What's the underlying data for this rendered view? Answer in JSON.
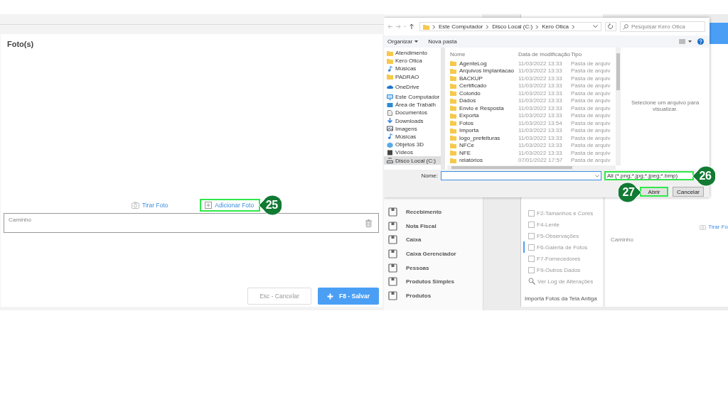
{
  "left_screen": {
    "title": "Foto(s)",
    "take_photo": {
      "label": "Tirar Foto"
    },
    "add_photo": {
      "label": "Adicionar Foto",
      "highlighted": true,
      "callout": "25"
    },
    "path_field": {
      "placeholder": "Caminho"
    },
    "buttons": [
      {
        "label": "Esc - Cancelar",
        "kind": "secondary"
      },
      {
        "label": "F8 - Salvar",
        "kind": "primary"
      }
    ]
  },
  "right_screen": {
    "app_sidebar": [
      {
        "label": "Recebimento"
      },
      {
        "label": "Nota Fiscal"
      },
      {
        "label": "Caixa"
      },
      {
        "label": "Caixa Gerenciador"
      },
      {
        "label": "Pessoas"
      },
      {
        "label": "Produtos Simples"
      },
      {
        "label": "Produtos"
      }
    ],
    "tabs": [
      {
        "label": "F2-Tamanhos  e Cores",
        "selected": false
      },
      {
        "label": "F4-Lente",
        "selected": false
      },
      {
        "label": "F5-Observações",
        "selected": false
      },
      {
        "label": "F6-Galeria de Fotos",
        "selected": true
      },
      {
        "label": "F7-Fornecedores",
        "selected": false
      },
      {
        "label": "F9-Outros Dados",
        "selected": false
      }
    ],
    "log_link": "Ver Log de Alterações",
    "import_button": "Importa Fotos da Tela Antiga",
    "take_photo": "Tirar Fo",
    "path_label": "Caminho",
    "file_dialog": {
      "breadcrumb": [
        "Este Computador",
        "Disco Local (C:)",
        "Kero Otica"
      ],
      "search": {
        "placeholder": "Pesquisar Kero Otica"
      },
      "toolbar": [
        {
          "label": "Organizar",
          "dropdown": true
        },
        {
          "label": "Nova pasta",
          "dropdown": false
        }
      ],
      "nav": [
        {
          "label": "Atendimento",
          "kind": "folder",
          "selected": false
        },
        {
          "label": "Kero Otica",
          "kind": "folder",
          "selected": false
        },
        {
          "label": "Músicas",
          "kind": "music",
          "selected": false
        },
        {
          "label": "PADRAO",
          "kind": "folder",
          "selected": false
        },
        {
          "label": "OneDrive",
          "kind": "cloud",
          "selected": false
        },
        {
          "label": "Este Computador",
          "kind": "computer",
          "selected": false
        },
        {
          "label": "Área de Trabalh",
          "kind": "desktop",
          "selected": false
        },
        {
          "label": "Documentos",
          "kind": "documents",
          "selected": false
        },
        {
          "label": "Downloads",
          "kind": "downloads",
          "selected": false
        },
        {
          "label": "Imagens",
          "kind": "pictures",
          "selected": false
        },
        {
          "label": "Músicas",
          "kind": "music",
          "selected": false
        },
        {
          "label": "Objetos 3D",
          "kind": "objects",
          "selected": false
        },
        {
          "label": "Vídeos",
          "kind": "videos",
          "selected": false
        },
        {
          "label": "Disco Local (C:)",
          "kind": "drive",
          "selected": true
        }
      ],
      "columns": [
        "Nome",
        "Data de modificação",
        "Tipo"
      ],
      "files": [
        {
          "name": "AgenteLog",
          "modified": "11/03/2022 13:33",
          "type": "Pasta de arquiv"
        },
        {
          "name": "Arquivos Implantacao",
          "modified": "11/03/2022 13:33",
          "type": "Pasta de arquiv"
        },
        {
          "name": "BACKUP",
          "modified": "11/03/2022 13:33",
          "type": "Pasta de arquiv"
        },
        {
          "name": "Certificado",
          "modified": "11/03/2022 13:33",
          "type": "Pasta de arquiv"
        },
        {
          "name": "Colorido",
          "modified": "11/03/2022 13:33",
          "type": "Pasta de arquiv"
        },
        {
          "name": "Dados",
          "modified": "11/03/2022 13:33",
          "type": "Pasta de arquiv"
        },
        {
          "name": "Envio e Resposta",
          "modified": "11/03/2022 13:33",
          "type": "Pasta de arquiv"
        },
        {
          "name": "Exporta",
          "modified": "11/03/2022 13:33",
          "type": "Pasta de arquiv"
        },
        {
          "name": "Fotos",
          "modified": "11/03/2022 13:54",
          "type": "Pasta de arquiv"
        },
        {
          "name": "Importa",
          "modified": "11/03/2022 13:33",
          "type": "Pasta de arquiv"
        },
        {
          "name": "logo_prefeituras",
          "modified": "11/03/2022 13:33",
          "type": "Pasta de arquiv"
        },
        {
          "name": "NFCe",
          "modified": "11/03/2022 13:33",
          "type": "Pasta de arquiv"
        },
        {
          "name": "NFE",
          "modified": "11/03/2022 13:33",
          "type": "Pasta de arquiv"
        },
        {
          "name": "relatórios",
          "modified": "07/01/2022 17:57",
          "type": "Pasta de arquiv"
        }
      ],
      "preview_hint": "Selecione um arquivo para visualizar.",
      "name_label": "Nome:",
      "filter": {
        "value": "All (*.png;*.jpg;*.jpeg;*.bmp)",
        "highlighted": true,
        "callout": "26"
      },
      "buttons": [
        {
          "label": "Abrir",
          "kind": "primary",
          "highlighted": true,
          "callout": "27"
        },
        {
          "label": "Cancelar",
          "kind": "secondary",
          "highlighted": false
        }
      ]
    }
  }
}
